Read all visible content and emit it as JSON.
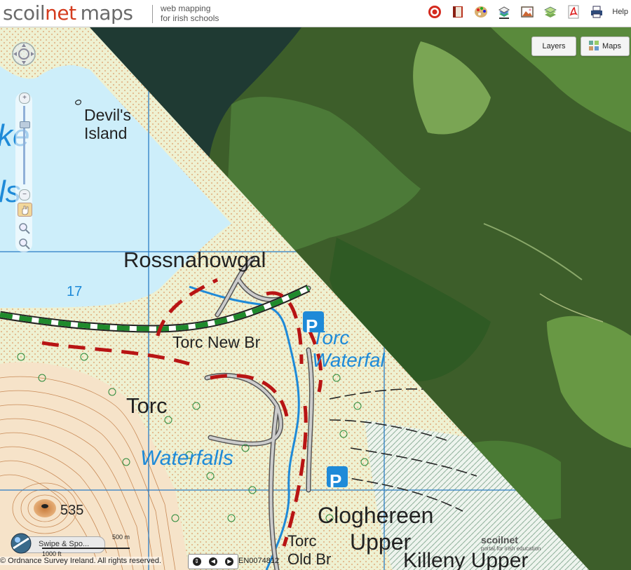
{
  "app": {
    "logo_scoil": "scoil",
    "logo_net": "net",
    "logo_maps": "maps",
    "tagline_line1": "web mapping",
    "tagline_line2": "for irish schools",
    "help_label": "Help"
  },
  "toolbar": {
    "icons": [
      "target-icon",
      "book-icon",
      "palette-icon",
      "layers-stack-icon",
      "picture-icon",
      "map-stack-icon",
      "pdf-icon",
      "print-icon"
    ]
  },
  "map_controls": {
    "layers_label": "Layers",
    "maps_label": "Maps",
    "swipe_label": "Swipe & Spo...",
    "scale_label_m": "500 m",
    "scale_label_ft": "1000 ft"
  },
  "map_labels": {
    "island_line1": "Devil's",
    "island_line2": "Island",
    "lake_fragment1": "ke",
    "lake_fragment2": "ls",
    "place1": "Rossnahowgal",
    "grid_number": "17",
    "bridge1": "Torc New Br",
    "waterfall1_line1": "Torc",
    "waterfall1_line2": "Waterfal",
    "place2": "Torc",
    "waterfall2": "Waterfalls",
    "spot_height": "535",
    "place3": "Cloghereen",
    "place3b": "Upper",
    "bridge2_line1": "Torc",
    "bridge2_line2": "Old Br",
    "place4": "Killeny Upper",
    "parking_symbol": "P"
  },
  "footer": {
    "copyright": "© Ordnance Survey Ireland. All rights reserved.",
    "licence": "EN0074812",
    "watermark_line1": "scoilnet",
    "watermark_line2": "portal for irish education"
  },
  "colors": {
    "accent_red": "#d43c1e",
    "lake_blue": "#cdeefa",
    "grid_line": "#2a7cc4",
    "land_cream": "#eef1d2",
    "aerial_green": "#3d5e2a"
  }
}
